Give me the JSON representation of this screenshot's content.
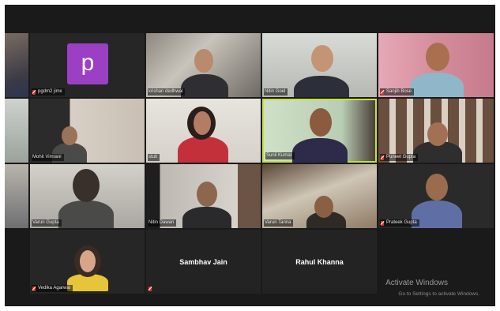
{
  "participants": [
    {
      "name": "pgdm2 jimx",
      "muted": true
    },
    {
      "name": "krishan dedhwal",
      "muted": false
    },
    {
      "name": "Nitin Goel",
      "muted": false
    },
    {
      "name": "Sanjib Bose",
      "muted": true
    },
    {
      "name": "Mohit Vimrani",
      "muted": false
    },
    {
      "name": "stuti",
      "muted": false
    },
    {
      "name": "Sunil Kumar",
      "muted": false,
      "active_speaker": true
    },
    {
      "name": "Puneet Gupta",
      "muted": true
    },
    {
      "name": "Varun Gupta",
      "muted": false
    },
    {
      "name": "Nitin Dawan",
      "muted": false
    },
    {
      "name": "Varun Tanna",
      "muted": false
    },
    {
      "name": "Prateek Gupta",
      "muted": true
    },
    {
      "name": "Vedika Agarwal",
      "muted": true
    },
    {
      "name": "Sambhav Jain",
      "muted": true
    },
    {
      "name": "Rahul Khanna",
      "muted": false
    }
  ],
  "avatar_letter": "p",
  "colors": {
    "active_speaker_border": "#c6e23b",
    "avatar_bg": "#9b3fc4",
    "mic_muted": "#e0352b"
  },
  "watermark": {
    "title": "Activate Windows",
    "subtitle": "Go to Settings to activate Windows."
  }
}
